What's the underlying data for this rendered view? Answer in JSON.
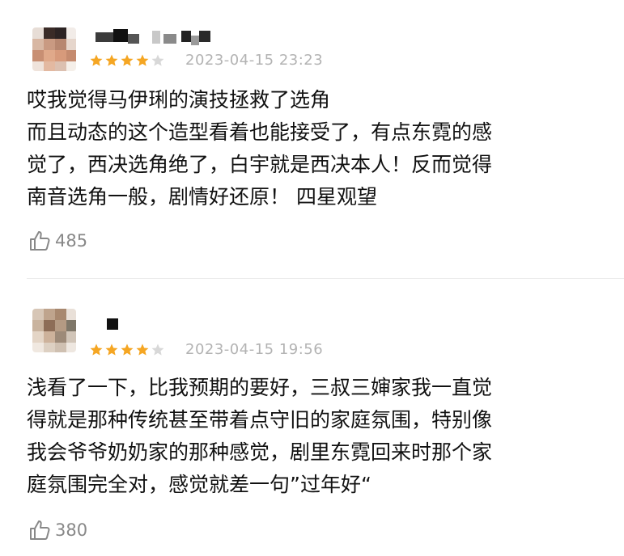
{
  "colors": {
    "star_filled": "#f5a623",
    "star_empty": "#d8d8d8",
    "date": "#b3b3b3",
    "like": "#888888"
  },
  "reviews": [
    {
      "rating": 4,
      "max_rating": 5,
      "date": "2023-04-15 23:23",
      "lines": [
        "哎我觉得马伊琍的演技拯救了选角",
        "而且动态的这个造型看着也能接受了，有点东霓的感",
        "觉了，西决选角绝了，白宇就是西决本人！反而觉得",
        "南音选角一般，剧情好还原！ 四星观望"
      ],
      "likes": "485"
    },
    {
      "rating": 4,
      "max_rating": 5,
      "date": "2023-04-15 19:56",
      "lines": [
        "浅看了一下，比我预期的要好，三叔三婶家我一直觉",
        "得就是那种传统甚至带着点守旧的家庭氛围，特别像",
        "我会爷爷奶奶家的那种感觉，剧里东霓回来时那个家",
        "庭氛围完全对，感觉就差一句”过年好“"
      ],
      "likes": "380"
    }
  ],
  "icons": {
    "star": "star-icon",
    "like": "thumbs-up-icon",
    "avatar": "blurred-avatar"
  }
}
